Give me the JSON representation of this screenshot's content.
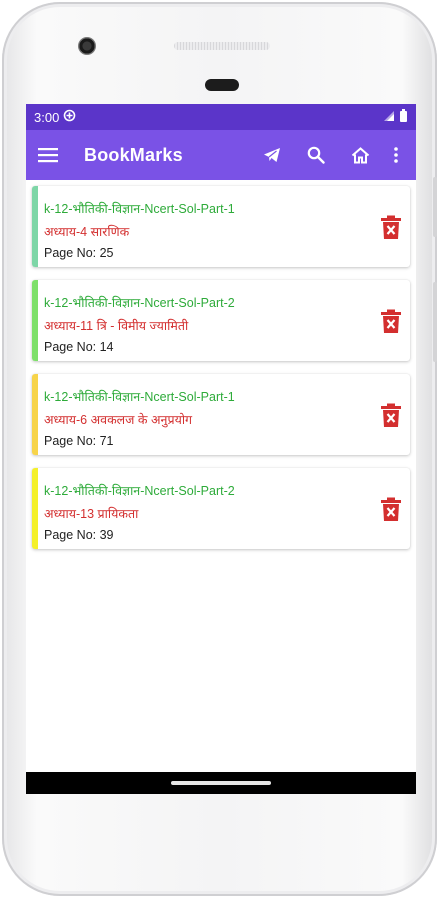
{
  "status_bar": {
    "time": "3:00"
  },
  "app_bar": {
    "title": "BookMarks"
  },
  "bookmarks": [
    {
      "book": "k-12-भौतिकी-विज्ञान-Ncert-Sol-Part-1",
      "chapter": "अध्याय-4 सारणिक",
      "page": "Page No: 25",
      "accent": "#7ed6a7"
    },
    {
      "book": "k-12-भौतिकी-विज्ञान-Ncert-Sol-Part-2",
      "chapter": "अध्याय-11 त्रि - विमीय ज्यामिती",
      "page": "Page No: 14",
      "accent": "#7ee06a"
    },
    {
      "book": "k-12-भौतिकी-विज्ञान-Ncert-Sol-Part-1",
      "chapter": "अध्याय-6 अवकलज के अनुप्रयोग",
      "page": "Page No: 71",
      "accent": "#f7d44a"
    },
    {
      "book": "k-12-भौतिकी-विज्ञान-Ncert-Sol-Part-2",
      "chapter": "अध्याय-13 प्रायिकता",
      "page": "Page No: 39",
      "accent": "#f4f02a"
    }
  ],
  "colors": {
    "status_bar": "#5b35c9",
    "app_bar": "#7a52e6",
    "book_text": "#2eab3a",
    "chapter_text": "#d32f2f",
    "delete_icon": "#d32f2f"
  },
  "icons": {
    "menu": "menu-icon",
    "share": "telegram-icon",
    "search": "search-icon",
    "home": "home-icon",
    "overflow": "more-vert-icon",
    "delete": "delete-icon"
  }
}
